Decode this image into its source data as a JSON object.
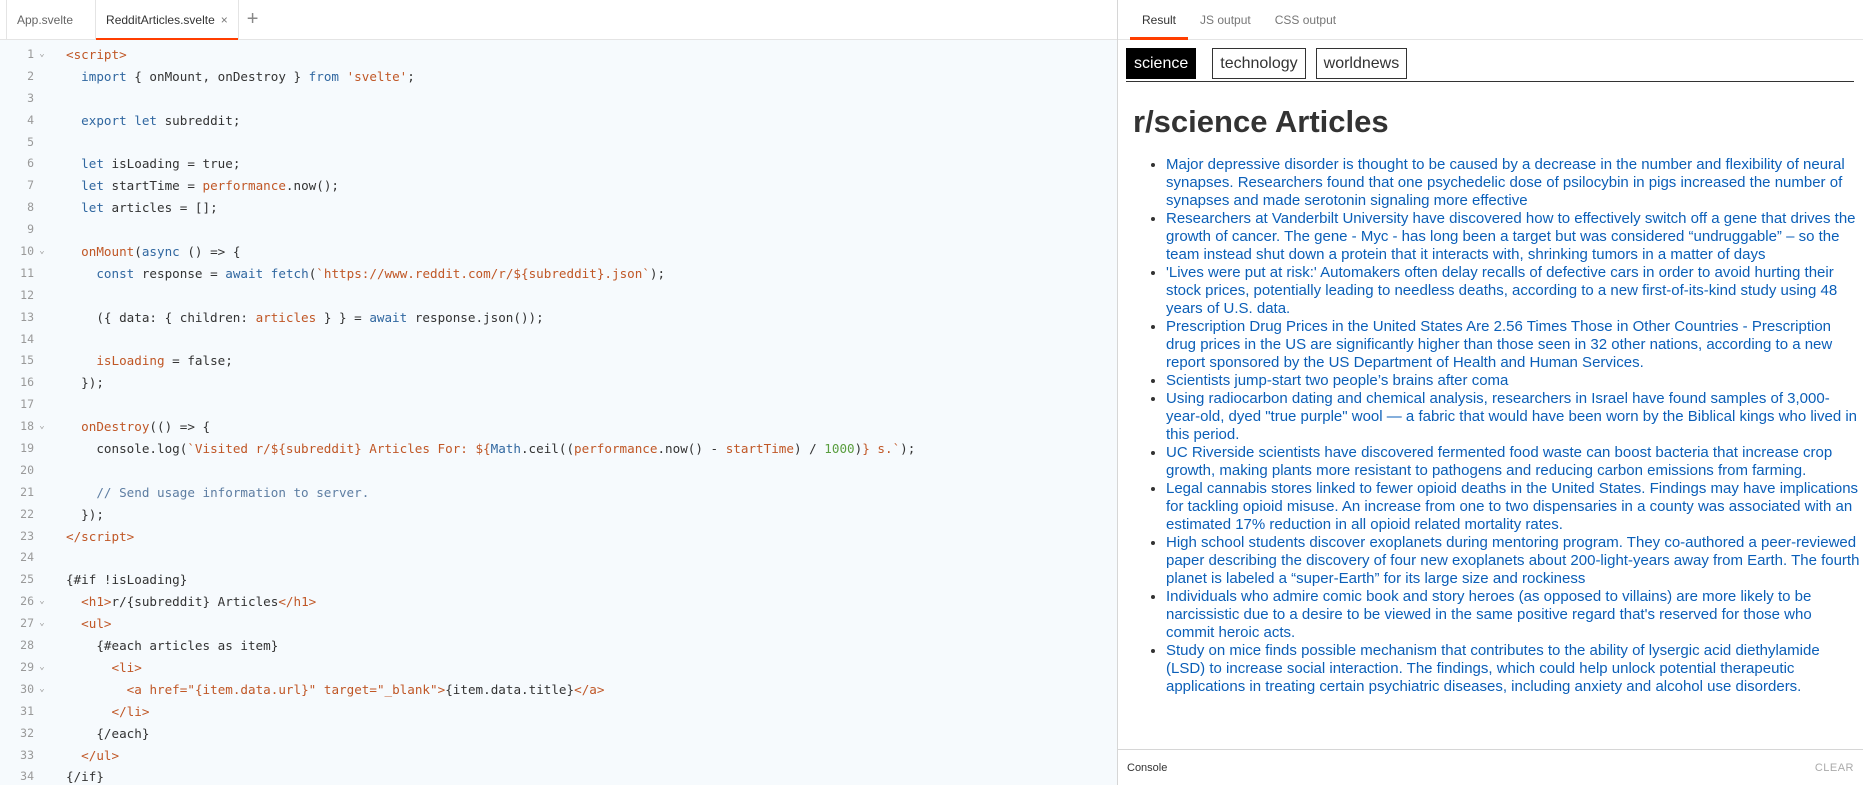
{
  "editor": {
    "tabs": [
      {
        "label": "App.svelte"
      },
      {
        "label": "RedditArticles.svelte"
      }
    ],
    "close_glyph": "×",
    "add_glyph": "+",
    "fold_glyph": "⌄",
    "lines": [
      {
        "n": "1",
        "fold": true,
        "html": "<span class=\"c-tag\">&lt;script&gt;</span>"
      },
      {
        "n": "2",
        "fold": false,
        "html": "  <span class=\"c-kw\">import</span> { onMount, onDestroy } <span class=\"c-kw\">from</span> <span class=\"c-str\">'svelte'</span>;"
      },
      {
        "n": "3",
        "fold": false,
        "html": ""
      },
      {
        "n": "4",
        "fold": false,
        "html": "  <span class=\"c-kw\">export</span> <span class=\"c-kw\">let</span> subreddit;"
      },
      {
        "n": "5",
        "fold": false,
        "html": ""
      },
      {
        "n": "6",
        "fold": false,
        "html": "  <span class=\"c-kw\">let</span> isLoading = true;"
      },
      {
        "n": "7",
        "fold": false,
        "html": "  <span class=\"c-kw\">let</span> startTime = <span class=\"c-var\">performance</span>.now();"
      },
      {
        "n": "8",
        "fold": false,
        "html": "  <span class=\"c-kw\">let</span> articles = [];"
      },
      {
        "n": "9",
        "fold": false,
        "html": ""
      },
      {
        "n": "10",
        "fold": true,
        "html": "  <span class=\"c-var\">onMount</span>(<span class=\"c-kw\">async</span> () =&gt; {"
      },
      {
        "n": "11",
        "fold": false,
        "html": "    <span class=\"c-kw\">const</span> response = <span class=\"c-kw\">await</span> <span class=\"c-kw\">fetch</span>(<span class=\"c-str\">`https://www.reddit.com/r/${subreddit}.json`</span>);"
      },
      {
        "n": "12",
        "fold": false,
        "html": ""
      },
      {
        "n": "13",
        "fold": false,
        "html": "    ({ data: { children: <span class=\"c-var\">articles</span> } } = <span class=\"c-kw\">await</span> response.json());"
      },
      {
        "n": "14",
        "fold": false,
        "html": ""
      },
      {
        "n": "15",
        "fold": false,
        "html": "    <span class=\"c-var\">isLoading</span> = false;"
      },
      {
        "n": "16",
        "fold": false,
        "html": "  });"
      },
      {
        "n": "17",
        "fold": false,
        "html": ""
      },
      {
        "n": "18",
        "fold": true,
        "html": "  <span class=\"c-var\">onDestroy</span>(() =&gt; {"
      },
      {
        "n": "19",
        "fold": false,
        "html": "    console.log(<span class=\"c-str\">`Visited r/${subreddit} Articles For: ${</span><span class=\"c-kw\">Math</span>.ceil((<span class=\"c-var\">performance</span>.now() - <span class=\"c-var\">startTime</span>) / <span class=\"c-num\">1000</span>)<span class=\"c-str\">} s.`</span>);"
      },
      {
        "n": "20",
        "fold": false,
        "html": ""
      },
      {
        "n": "21",
        "fold": false,
        "html": "    <span class=\"c-com\">// Send usage information to server.</span>"
      },
      {
        "n": "22",
        "fold": false,
        "html": "  });"
      },
      {
        "n": "23",
        "fold": false,
        "html": "<span class=\"c-tag\">&lt;/script&gt;</span>"
      },
      {
        "n": "24",
        "fold": false,
        "html": ""
      },
      {
        "n": "25",
        "fold": false,
        "html": "{#if !isLoading}"
      },
      {
        "n": "26",
        "fold": true,
        "html": "  <span class=\"c-tag\">&lt;h1&gt;</span>r/{subreddit} Articles<span class=\"c-tag\">&lt;/h1&gt;</span>"
      },
      {
        "n": "27",
        "fold": true,
        "html": "  <span class=\"c-tag\">&lt;ul&gt;</span>"
      },
      {
        "n": "28",
        "fold": false,
        "html": "    {#each articles as item}"
      },
      {
        "n": "29",
        "fold": true,
        "html": "      <span class=\"c-tag\">&lt;li&gt;</span>"
      },
      {
        "n": "30",
        "fold": true,
        "html": "        <span class=\"c-tag\">&lt;a</span> <span class=\"c-attr\">href=</span><span class=\"c-str\">\"{item.data.url}\"</span> <span class=\"c-attr\">target=</span><span class=\"c-str\">\"_blank\"</span><span class=\"c-tag\">&gt;</span>{item.data.title}<span class=\"c-tag\">&lt;/a&gt;</span>"
      },
      {
        "n": "31",
        "fold": false,
        "html": "      <span class=\"c-tag\">&lt;/li&gt;</span>"
      },
      {
        "n": "32",
        "fold": false,
        "html": "    {/each}"
      },
      {
        "n": "33",
        "fold": false,
        "html": "  <span class=\"c-tag\">&lt;/ul&gt;</span>"
      },
      {
        "n": "34",
        "fold": false,
        "html": "{/if}"
      }
    ]
  },
  "output": {
    "tabs": [
      {
        "label": "Result"
      },
      {
        "label": "JS output"
      },
      {
        "label": "CSS output"
      }
    ],
    "subreddit_buttons": [
      {
        "label": "science"
      },
      {
        "label": "technology"
      },
      {
        "label": "worldnews"
      }
    ],
    "heading": "r/science Articles",
    "articles": [
      "Major depressive disorder is thought to be caused by a decrease in the number and flexibility of neural synapses. Researchers found that one psychedelic dose of psilocybin in pigs increased the number of synapses and made serotonin signaling more effective",
      "Researchers at Vanderbilt University have discovered how to effectively switch off a gene that drives the growth of cancer. The gene - Myc - has long been a target but was considered “undruggable” – so the team instead shut down a protein that it interacts with, shrinking tumors in a matter of days",
      "'Lives were put at risk:' Automakers often delay recalls of defective cars in order to avoid hurting their stock prices, potentially leading to needless deaths, according to a new first-of-its-kind study using 48 years of U.S. data.",
      "Prescription Drug Prices in the United States Are 2.56 Times Those in Other Countries - Prescription drug prices in the US are significantly higher than those seen in 32 other nations, according to a new report sponsored by the US Department of Health and Human Services.",
      "Scientists jump-start two people’s brains after coma",
      "Using radiocarbon dating and chemical analysis, researchers in Israel have found samples of 3,000-year-old, dyed \"true purple\" wool — a fabric that would have been worn by the Biblical kings who lived in this period.",
      "UC Riverside scientists have discovered fermented food waste can boost bacteria that increase crop growth, making plants more resistant to pathogens and reducing carbon emissions from farming.",
      "Legal cannabis stores linked to fewer opioid deaths in the United States. Findings may have implications for tackling opioid misuse. An increase from one to two dispensaries in a county was associated with an estimated 17% reduction in all opioid related mortality rates.",
      "High school students discover exoplanets during mentoring program. They co-authored a peer-reviewed paper describing the discovery of four new exoplanets about 200-light-years away from Earth. The fourth planet is labeled a “super-Earth” for its large size and rockiness",
      "Individuals who admire comic book and story heroes (as opposed to villains) are more likely to be narcissistic due to a desire to be viewed in the same positive regard that's reserved for those who commit heroic acts.",
      "Study on mice finds possible mechanism that contributes to the ability of lysergic acid diethylamide (LSD) to increase social interaction. The findings, which could help unlock potential therapeutic applications in treating certain psychiatric diseases, including anxiety and alcohol use disorders."
    ],
    "console_label": "Console",
    "clear_label": "CLEAR"
  },
  "colors": {
    "accent": "#ff3e00",
    "link": "#0b5fb8",
    "editor_bg": "#f6fafd"
  }
}
